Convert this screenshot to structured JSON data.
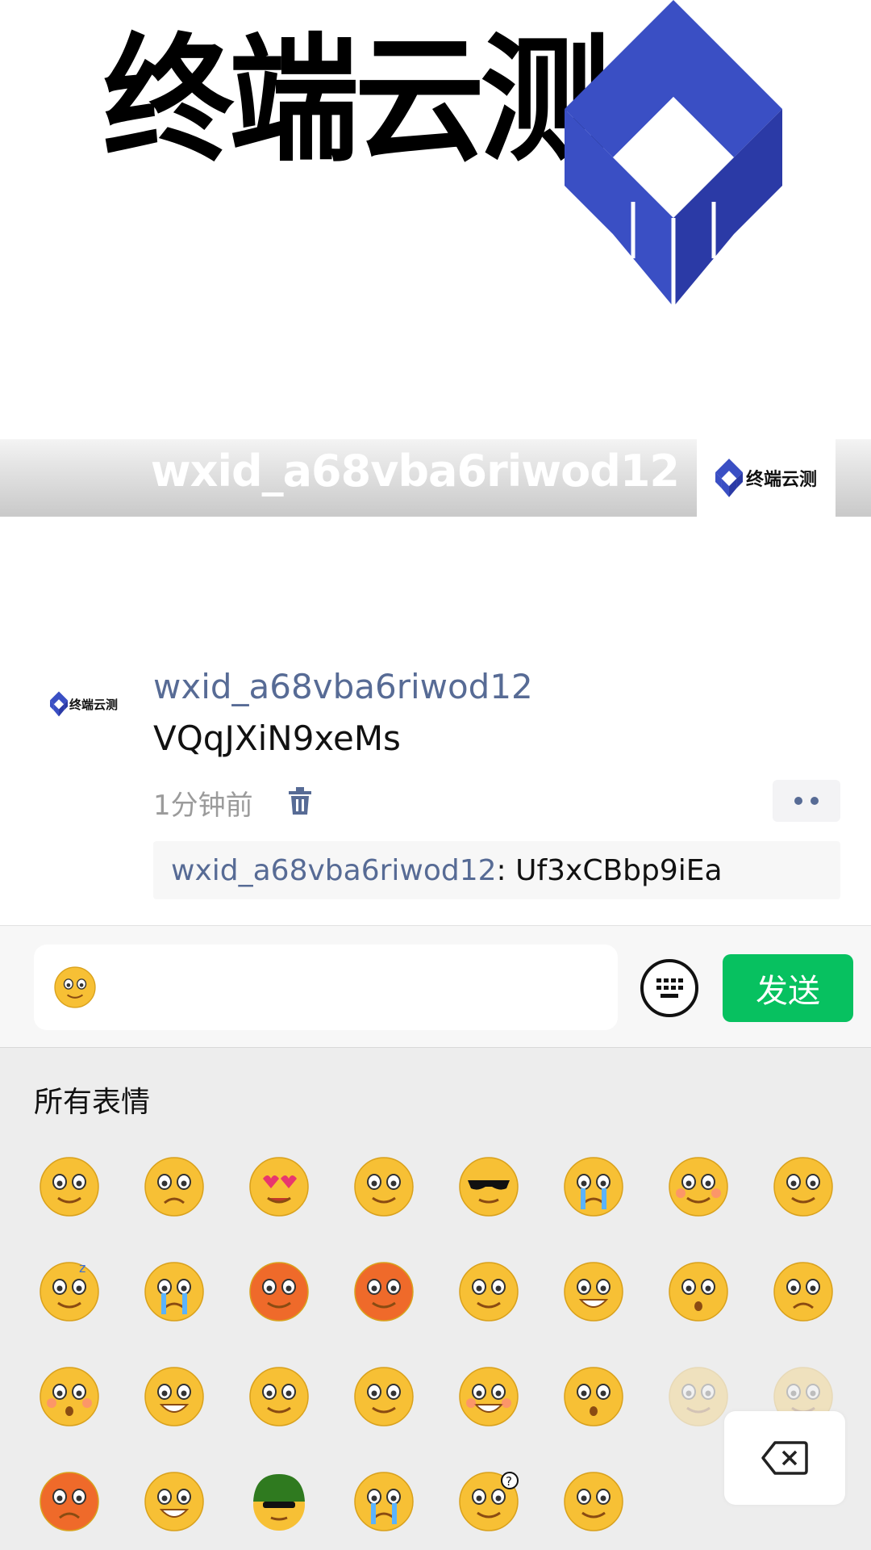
{
  "cover": {
    "brand_text": "终端云测"
  },
  "profile": {
    "name": "wxid_a68vba6riwod12",
    "brand_text": "终端云测"
  },
  "post": {
    "author": "wxid_a68vba6riwod12",
    "content": "VQqJXiN9xeMs",
    "time": "1分钟前",
    "brand_text": "终端云测",
    "comment": {
      "author": "wxid_a68vba6riwod12",
      "separator": ": ",
      "text": "Uf3xCBbp9iEa"
    }
  },
  "input": {
    "send_label": "发送",
    "emoji_icon": "smile-emoji-icon",
    "keyboard_icon": "keyboard-icon"
  },
  "emoji_panel": {
    "title": "所有表情",
    "emojis": [
      "smile",
      "awkward",
      "heart-eyes",
      "stare",
      "cool",
      "sob",
      "shy",
      "mouth-shut",
      "sleep",
      "cry",
      "sweat",
      "angry",
      "tongue",
      "grin",
      "surprise",
      "sad",
      "blush",
      "laugh",
      "puke",
      "chuckle",
      "happy",
      "shocked",
      "dizzy",
      "smug",
      "scared",
      "cheeky",
      "soldier",
      "tears",
      "doubt",
      "shush"
    ],
    "delete_icon": "backspace-icon"
  },
  "colors": {
    "brand_blue": "#3a4fc4",
    "link": "#576b95",
    "send": "#07c160",
    "emoji_yellow": "#f7c035"
  }
}
